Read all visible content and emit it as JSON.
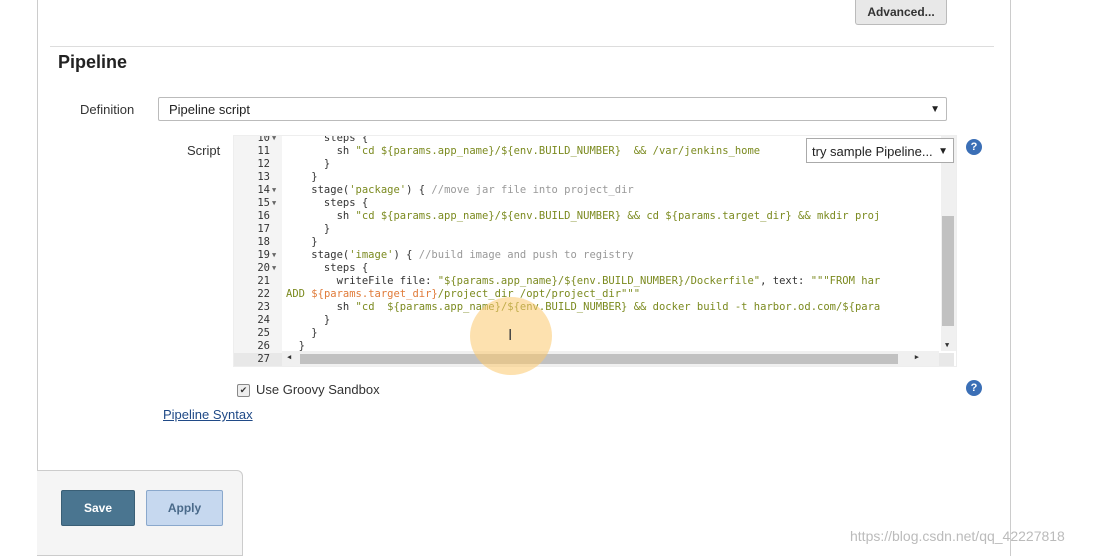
{
  "advanced_button": "Advanced...",
  "section_title": "Pipeline",
  "definition": {
    "label": "Definition",
    "value": "Pipeline script"
  },
  "script": {
    "label": "Script",
    "sample_dropdown": "try sample Pipeline...",
    "lines": [
      {
        "n": "10",
        "fold": true,
        "seg": [
          [
            "k",
            "      steps {"
          ]
        ]
      },
      {
        "n": "11",
        "seg": [
          [
            "k",
            "        sh "
          ],
          [
            "s",
            "\"cd ${params.app_name}/${env.BUILD_NUMBER}  && /var/jenkins_home"
          ]
        ]
      },
      {
        "n": "12",
        "seg": [
          [
            "k",
            "      }"
          ]
        ]
      },
      {
        "n": "13",
        "seg": [
          [
            "k",
            "    }"
          ]
        ]
      },
      {
        "n": "14",
        "fold": true,
        "seg": [
          [
            "k",
            "    stage("
          ],
          [
            "s",
            "'package'"
          ],
          [
            "k",
            ") { "
          ],
          [
            "c",
            "//move jar file into project_dir"
          ]
        ]
      },
      {
        "n": "15",
        "fold": true,
        "seg": [
          [
            "k",
            "      steps {"
          ]
        ]
      },
      {
        "n": "16",
        "seg": [
          [
            "k",
            "        sh "
          ],
          [
            "s",
            "\"cd ${params.app_name}/${env.BUILD_NUMBER} && cd ${params.target_dir} && mkdir proj"
          ]
        ]
      },
      {
        "n": "17",
        "seg": [
          [
            "k",
            "      }"
          ]
        ]
      },
      {
        "n": "18",
        "seg": [
          [
            "k",
            "    }"
          ]
        ]
      },
      {
        "n": "19",
        "fold": true,
        "seg": [
          [
            "k",
            "    stage("
          ],
          [
            "s",
            "'image'"
          ],
          [
            "k",
            ") { "
          ],
          [
            "c",
            "//build image and push to registry"
          ]
        ]
      },
      {
        "n": "20",
        "fold": true,
        "seg": [
          [
            "k",
            "      steps {"
          ]
        ]
      },
      {
        "n": "21",
        "seg": [
          [
            "k",
            "        writeFile file: "
          ],
          [
            "s",
            "\"${params.app_name}/${env.BUILD_NUMBER}/Dockerfile\""
          ],
          [
            "k",
            ", text: "
          ],
          [
            "s",
            "\"\"\"FROM har"
          ]
        ]
      },
      {
        "n": "22",
        "seg": [
          [
            "s",
            "ADD "
          ],
          [
            "o",
            "${params.target_dir}"
          ],
          [
            "s",
            "/project_dir /opt/project_dir\"\"\""
          ]
        ]
      },
      {
        "n": "23",
        "seg": [
          [
            "k",
            "        sh "
          ],
          [
            "s",
            "\"cd  ${params.app_name}/${env.BUILD_NUMBER} && docker build -t harbor.od.com/${para"
          ]
        ]
      },
      {
        "n": "24",
        "seg": [
          [
            "k",
            "      }"
          ]
        ]
      },
      {
        "n": "25",
        "seg": [
          [
            "k",
            "    }"
          ]
        ]
      },
      {
        "n": "26",
        "seg": [
          [
            "k",
            "  }"
          ]
        ]
      },
      {
        "n": "27",
        "active": true,
        "seg": [
          [
            "k",
            ""
          ]
        ]
      }
    ]
  },
  "sandbox": {
    "label": "Use Groovy Sandbox",
    "checked": true
  },
  "pipeline_syntax_link": "Pipeline Syntax",
  "buttons": {
    "save": "Save",
    "apply": "Apply"
  },
  "watermark": "https://blog.csdn.net/qq_42227818",
  "colors": {
    "save": "#4a7590",
    "apply": "#c6d8ef",
    "string": "#7b8a1f",
    "comment": "#999999",
    "help": "#3b6fb6"
  }
}
